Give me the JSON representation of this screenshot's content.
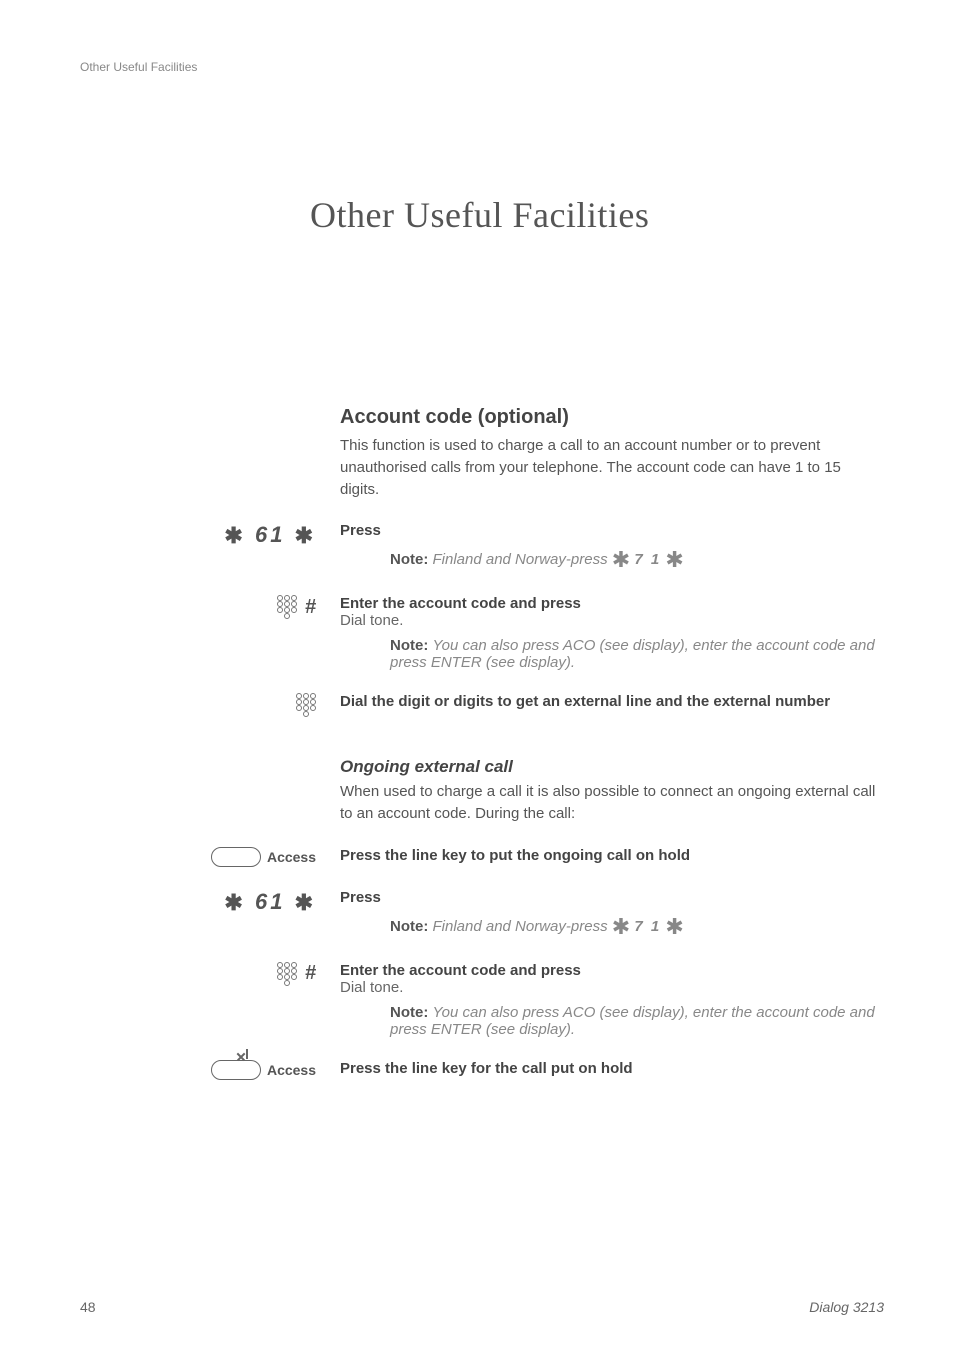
{
  "header": {
    "label": "Other Useful Facilities"
  },
  "chapter": {
    "title": "Other Useful Facilities"
  },
  "section_account": {
    "heading": "Account code (optional)",
    "desc": "This function is used to charge a call to an account number or to prevent unauthorised calls from your telephone. The account code can have 1 to 15 digits."
  },
  "steps": {
    "press1_code": "61",
    "press1_label": "Press",
    "note1_prefix": "Note:",
    "note1_text": "Finland and Norway-press",
    "note1_code": "7 1",
    "enter1_label": "Enter the account code and press",
    "enter1_sub": "Dial tone.",
    "note2_prefix": "Note:",
    "note2_text": "You can also press ACO (see display), enter the account code and press ENTER (see display).",
    "dial_label": "Dial the digit or digits to get an external line and the external number"
  },
  "ongoing": {
    "heading": "Ongoing external call",
    "desc": "When used to charge a call it is also possible to connect an ongoing external call to an account code. During the call:",
    "access1_label": "Access",
    "access1_action": "Press the line key to put the ongoing call on hold",
    "press2_code": "61",
    "press2_label": "Press",
    "note3_prefix": "Note:",
    "note3_text": "Finland and Norway-press",
    "note3_code": "7 1",
    "enter2_label": "Enter the account code and press",
    "enter2_sub": "Dial tone.",
    "note4_prefix": "Note:",
    "note4_text": "You can also press ACO (see display), enter the account code and press ENTER (see display).",
    "access2_label": "Access",
    "access2_action": "Press the line key for the call put on hold"
  },
  "footer": {
    "page": "48",
    "model": "Dialog 3213"
  }
}
